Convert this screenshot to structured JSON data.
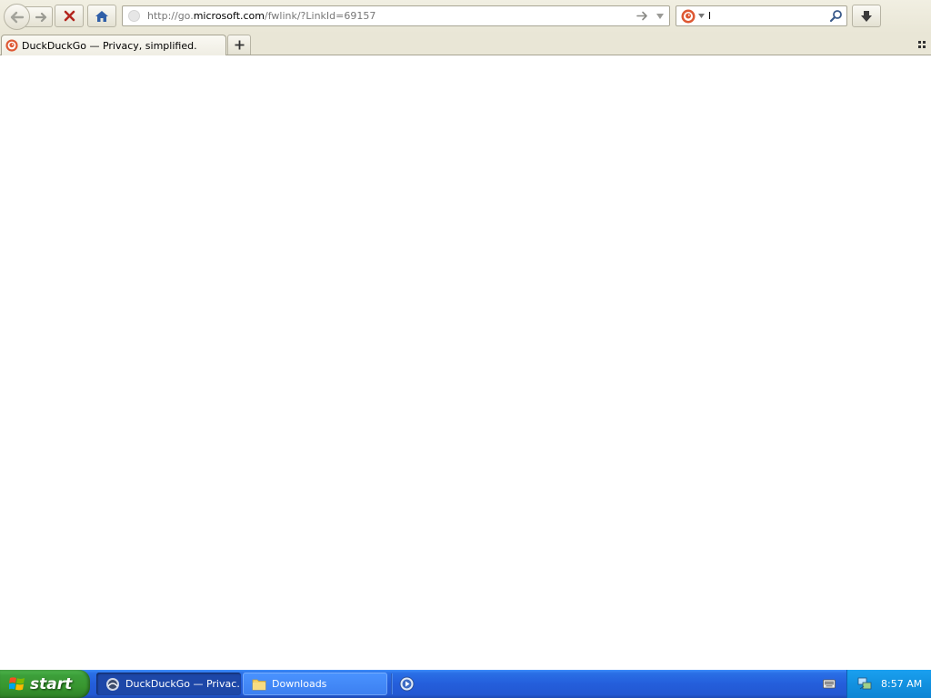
{
  "toolbar": {
    "url_prefix": "http://go.",
    "url_host": "microsoft.com",
    "url_suffix": "/fwlink/?LinkId=69157",
    "search_value": "l"
  },
  "tabs": [
    {
      "title": "DuckDuckGo — Privacy, simplified."
    }
  ],
  "taskbar": {
    "start_label": "start",
    "tasks": [
      {
        "label": "DuckDuckGo — Privac…"
      },
      {
        "label": "Downloads"
      }
    ],
    "clock": "8:57 AM"
  },
  "colors": {
    "taskbar_blue": "#245edb",
    "start_green": "#3c9f3a",
    "tray_blue": "#1291e0",
    "ddg_orange": "#de5833"
  }
}
